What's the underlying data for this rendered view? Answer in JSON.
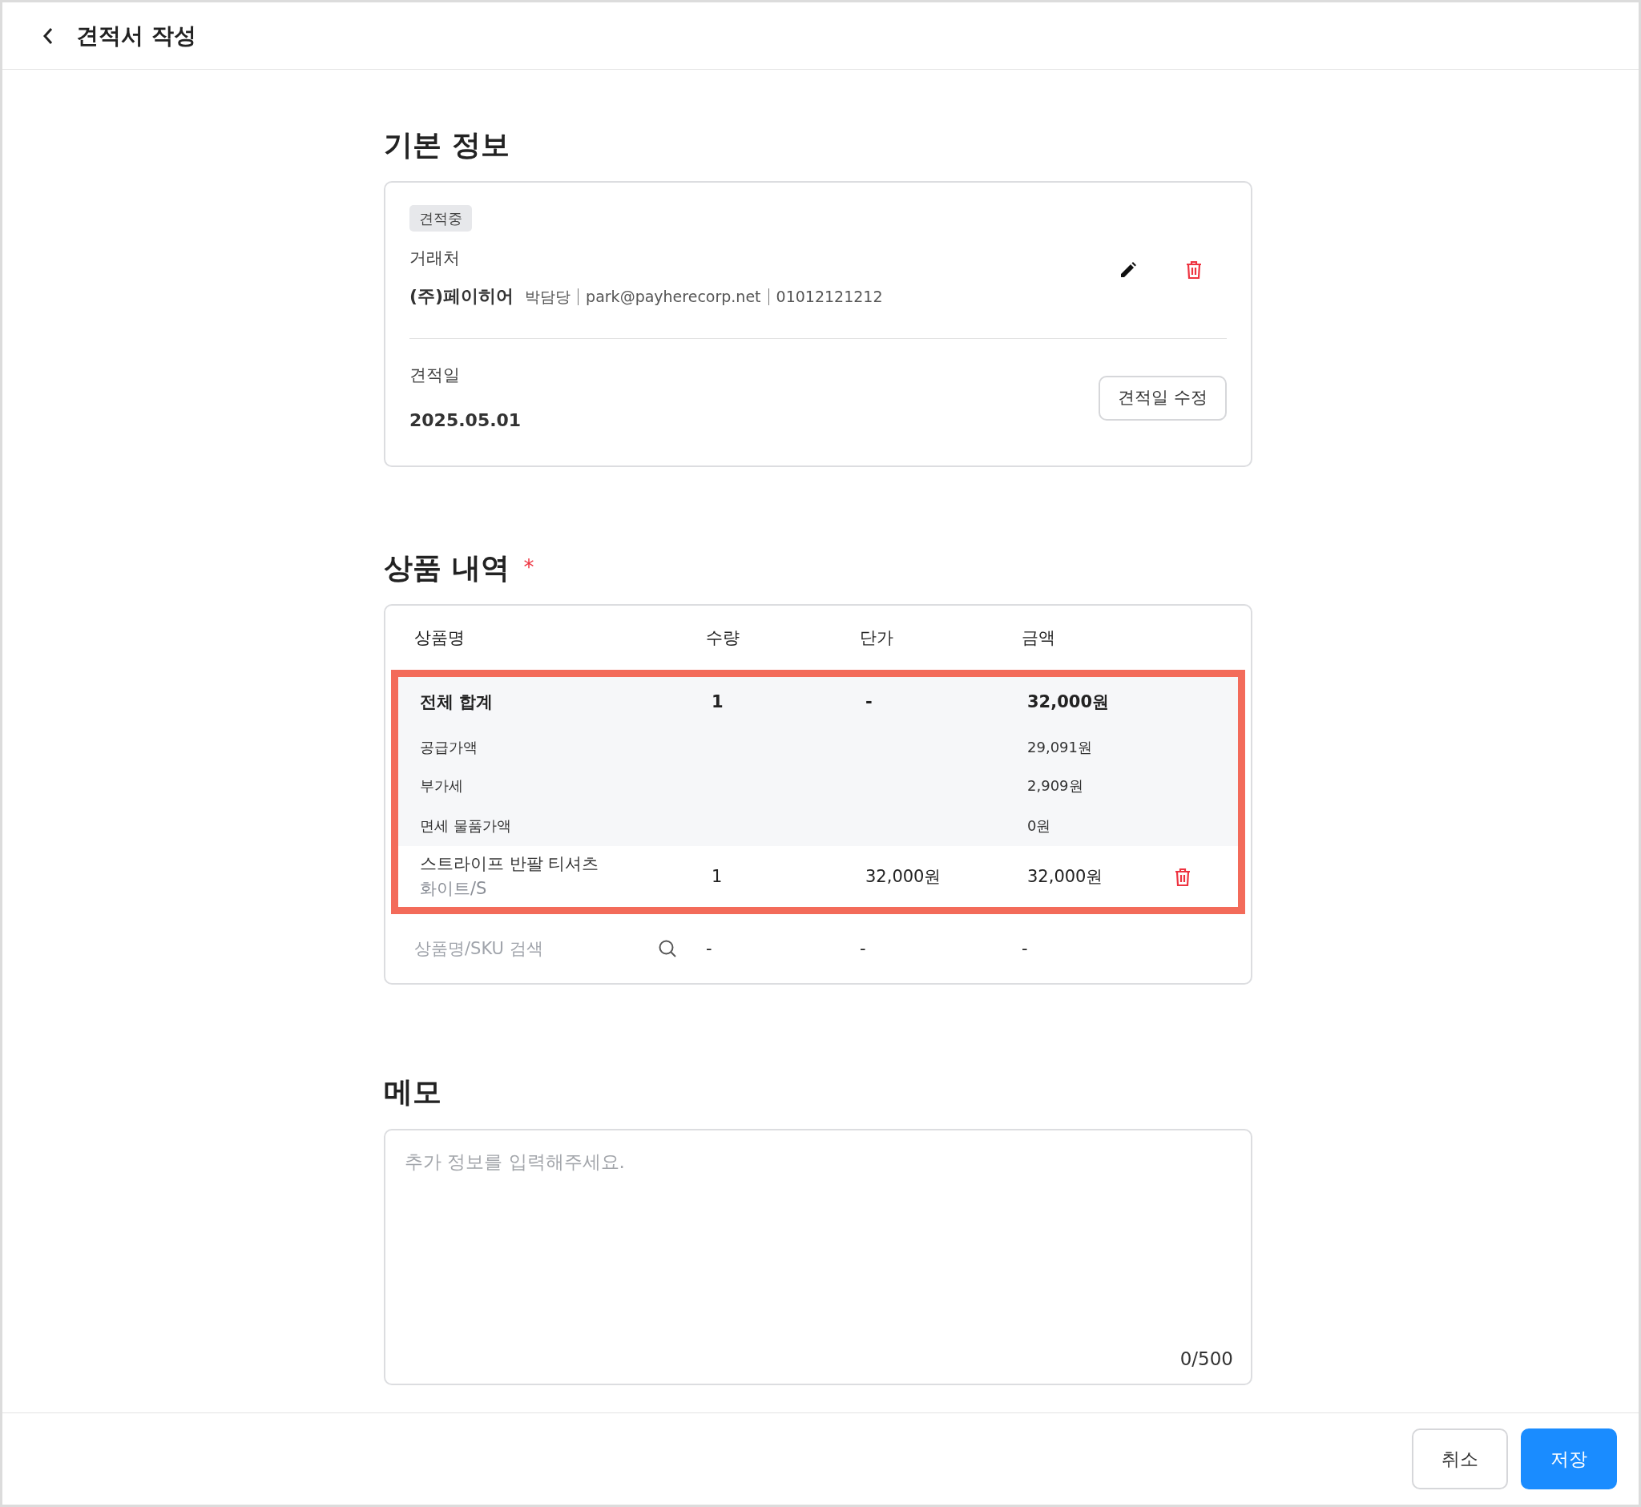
{
  "header": {
    "title": "견적서 작성"
  },
  "basic_info": {
    "title": "기본 정보",
    "status_badge": "견적중",
    "client_label": "거래처",
    "client_name": "(주)페이히어",
    "client_contact": [
      "박담당",
      "park@payherecorp.net",
      "01012121212"
    ],
    "date_label": "견적일",
    "date": "2025.05.01",
    "edit_date_button": "견적일 수정"
  },
  "products": {
    "title": "상품 내역",
    "required_mark": "*",
    "highlighted": true,
    "columns": [
      "상품명",
      "수량",
      "단가",
      "금액"
    ],
    "summary": {
      "label": "전체 합계",
      "qty": "1",
      "unit_price": "-",
      "amount": "32,000원"
    },
    "breakdown": [
      {
        "label": "공급가액",
        "amount": "29,091원"
      },
      {
        "label": "부가세",
        "amount": "2,909원"
      },
      {
        "label": "면세 물품가액",
        "amount": "0원"
      }
    ],
    "items": [
      {
        "name": "스트라이프 반팔 티셔츠",
        "option": "화이트/S",
        "qty": "1",
        "unit_price": "32,000원",
        "amount": "32,000원"
      }
    ],
    "search": {
      "placeholder": "상품명/SKU 검색",
      "qty": "-",
      "unit_price": "-",
      "amount": "-"
    }
  },
  "memo": {
    "title": "메모",
    "placeholder": "추가 정보를 입력해주세요.",
    "counter": "0/500"
  },
  "footer": {
    "buttons": [
      {
        "label": "취소",
        "kind": "secondary"
      },
      {
        "label": "저장",
        "kind": "primary"
      }
    ]
  }
}
